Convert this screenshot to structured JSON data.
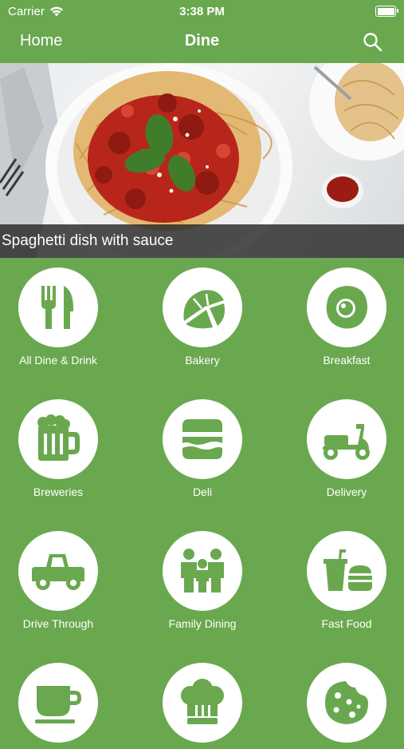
{
  "status": {
    "carrier": "Carrier",
    "time": "3:38 PM"
  },
  "nav": {
    "home_label": "Home",
    "title": "Dine"
  },
  "hero": {
    "caption": "Spaghetti dish with sauce"
  },
  "colors": {
    "brand_green": "#6aa84f",
    "icon_fill": "#6aa84f"
  },
  "categories": [
    {
      "label": "All Dine & Drink",
      "icon": "fork-knife-icon"
    },
    {
      "label": "Bakery",
      "icon": "croissant-icon"
    },
    {
      "label": "Breakfast",
      "icon": "fried-egg-icon"
    },
    {
      "label": "Breweries",
      "icon": "beer-mug-icon"
    },
    {
      "label": "Deli",
      "icon": "sandwich-icon"
    },
    {
      "label": "Delivery",
      "icon": "scooter-icon"
    },
    {
      "label": "Drive Through",
      "icon": "truck-icon"
    },
    {
      "label": "Family Dining",
      "icon": "family-icon"
    },
    {
      "label": "Fast Food",
      "icon": "fast-food-icon"
    },
    {
      "label": "",
      "icon": "coffee-cup-icon"
    },
    {
      "label": "",
      "icon": "chef-hat-icon"
    },
    {
      "label": "",
      "icon": "cookie-icon"
    }
  ]
}
